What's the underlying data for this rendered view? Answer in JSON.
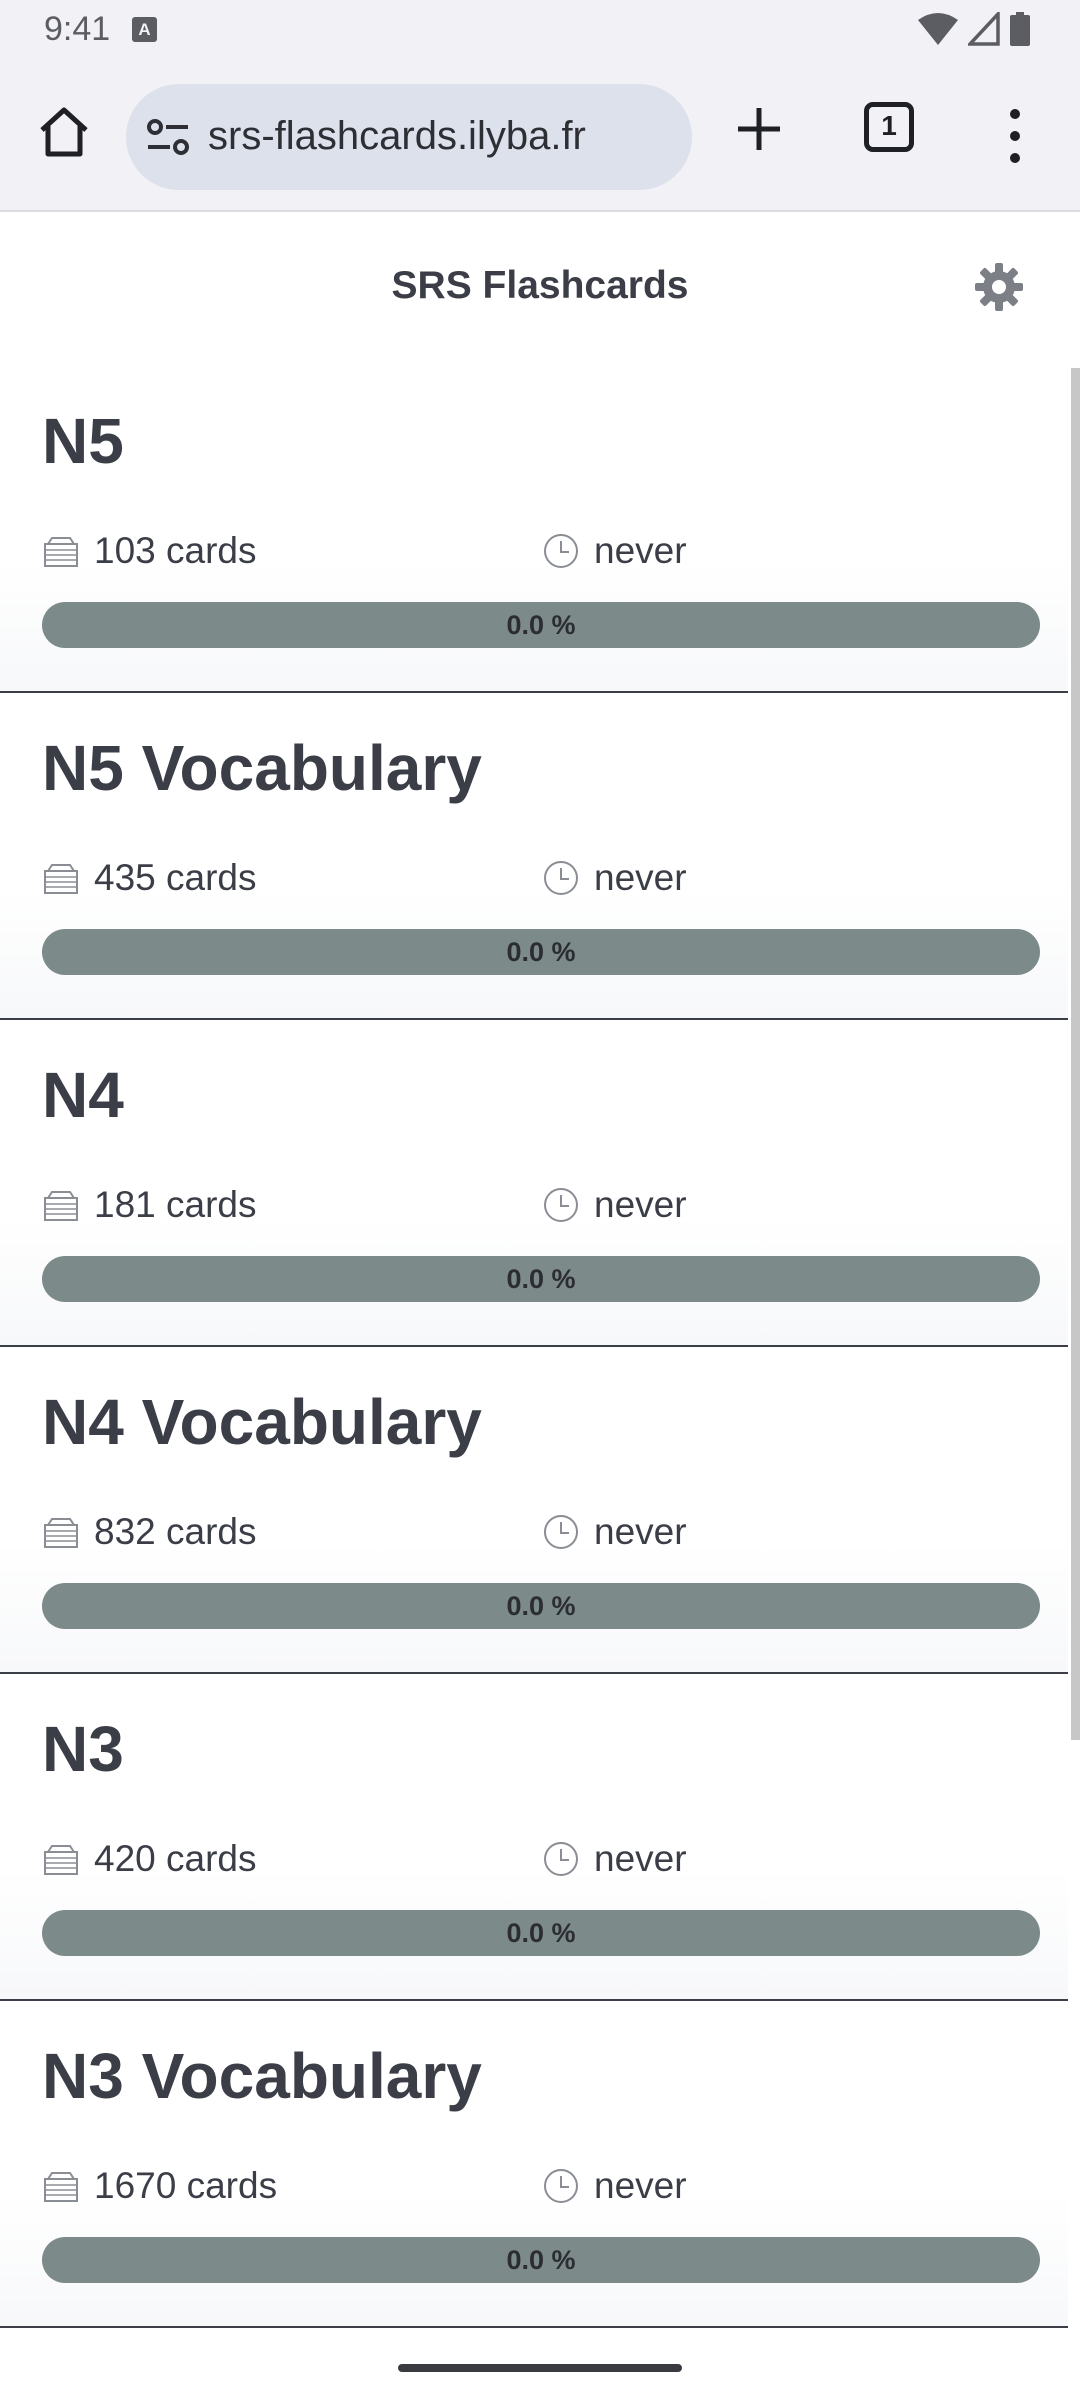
{
  "status_bar": {
    "time": "9:41",
    "icons": [
      "a-notification-icon",
      "wifi-icon",
      "signal-icon",
      "battery-icon"
    ]
  },
  "browser": {
    "url": "srs-flashcards.ilyba.fr",
    "tab_count": "1",
    "icons": [
      "home-icon",
      "tune-icon",
      "plus-icon",
      "tab-switcher-icon",
      "more-vert-icon"
    ]
  },
  "app": {
    "title": "SRS Flashcards",
    "settings_icon": "gear-icon"
  },
  "colors": {
    "progress_track": "#7c8b8a",
    "text": "#3b3e47",
    "browser_chrome": "#f1f1f6",
    "url_pill": "#dde1ec"
  },
  "decks": [
    {
      "title": "N5",
      "cards": "103 cards",
      "last_review": "never",
      "progress_label": "0.0 %",
      "progress": 0.0
    },
    {
      "title": "N5 Vocabulary",
      "cards": "435 cards",
      "last_review": "never",
      "progress_label": "0.0 %",
      "progress": 0.0
    },
    {
      "title": "N4",
      "cards": "181 cards",
      "last_review": "never",
      "progress_label": "0.0 %",
      "progress": 0.0
    },
    {
      "title": "N4 Vocabulary",
      "cards": "832 cards",
      "last_review": "never",
      "progress_label": "0.0 %",
      "progress": 0.0
    },
    {
      "title": "N3",
      "cards": "420 cards",
      "last_review": "never",
      "progress_label": "0.0 %",
      "progress": 0.0
    },
    {
      "title": "N3 Vocabulary",
      "cards": "1670 cards",
      "last_review": "never",
      "progress_label": "0.0 %",
      "progress": 0.0
    }
  ]
}
